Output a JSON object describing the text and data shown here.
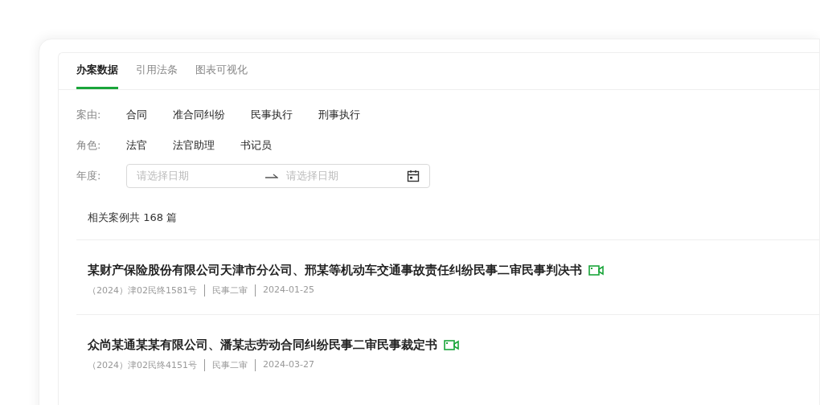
{
  "tabs": [
    {
      "label": "办案数据",
      "selected": true
    },
    {
      "label": "引用法条",
      "selected": false
    },
    {
      "label": "图表可视化",
      "selected": false
    }
  ],
  "filters": [
    {
      "label": "案由:",
      "options": [
        "合同",
        "准合同纠纷",
        "民事执行",
        "刑事执行"
      ]
    },
    {
      "label": "角色:",
      "options": [
        "法官",
        "法官助理",
        "书记员"
      ]
    }
  ],
  "year": {
    "label": "年度:",
    "start_placeholder": "请选择日期",
    "end_placeholder": "请选择日期"
  },
  "summary": "相关案例共 168 篇",
  "cases": [
    {
      "title": "某财产保险股份有限公司天津市分公司、邢某等机动车交通事故责任纠纷民事二审民事判决书",
      "meta": [
        "（2024）津02民终1581号",
        "民事二审",
        "2024-01-25"
      ]
    },
    {
      "title": "众尚某通某某有限公司、潘某志劳动合同纠纷民事二审民事裁定书",
      "meta": [
        "（2024）津02民终4151号",
        "民事二审",
        "2024-03-27"
      ]
    }
  ]
}
